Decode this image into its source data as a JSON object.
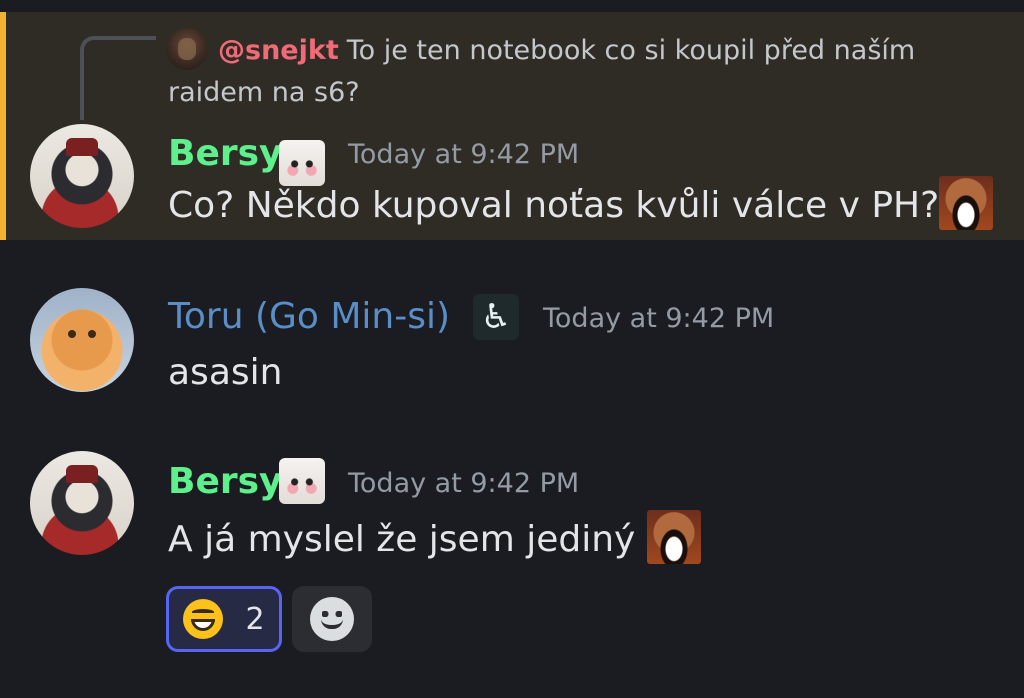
{
  "messages": [
    {
      "author": "Bersy",
      "timestamp": "Today at 9:42 PM",
      "text": "Co? Někdo kupoval noťas kvůli válce v PH?",
      "highlighted": true,
      "emote": "laughing-man-emote",
      "reply": {
        "mention": "@snejkt",
        "text": "To je ten notebook co si koupil před naším raidem na s6?"
      }
    },
    {
      "author": "Toru (Go Min-si)",
      "timestamp": "Today at 9:42 PM",
      "text": "asasin",
      "role_icon": "wheelchair-icon"
    },
    {
      "author": "Bersy",
      "timestamp": "Today at 9:42 PM",
      "text": "A já myslel že jsem jediný",
      "emote": "laughing-man-emote",
      "reactions": [
        {
          "emoji": "grinning-face-emoji",
          "count": "2",
          "active": true
        }
      ],
      "add_reaction_icon": "add-reaction-icon"
    }
  ],
  "colors": {
    "background": "#1b1c22",
    "mention_highlight": "#2f2c25",
    "mention_bar": "#f0b232",
    "bersy_name": "#5ef08c",
    "toru_name": "#5a8ec7",
    "mention_text": "#f06b77",
    "timestamp": "#949ba4",
    "reaction_border": "#5865f2"
  }
}
